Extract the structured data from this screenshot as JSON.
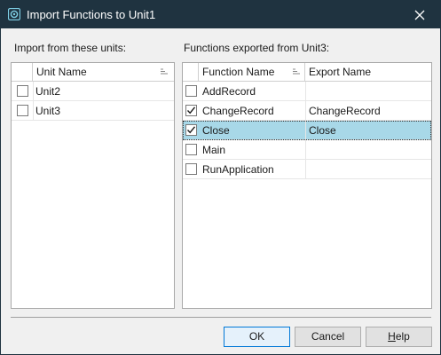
{
  "window": {
    "title": "Import Functions to Unit1",
    "colors": {
      "titlebar": "#1f3340",
      "selection": "#a8d8e8"
    },
    "icons": {
      "app": "app-icon",
      "close": "close-icon"
    }
  },
  "left_panel": {
    "label": "Import from these units:",
    "column_header": "Unit Name",
    "rows": [
      {
        "label": "Unit2",
        "checked": false
      },
      {
        "label": "Unit3",
        "checked": false
      }
    ]
  },
  "right_panel": {
    "label": "Functions exported from Unit3:",
    "columns": [
      "Function Name",
      "Export Name"
    ],
    "rows": [
      {
        "function": "AddRecord",
        "export": "",
        "checked": false
      },
      {
        "function": "ChangeRecord",
        "export": "ChangeRecord",
        "checked": true
      },
      {
        "function": "Close",
        "export": "Close",
        "checked": true,
        "selected": true
      },
      {
        "function": "Main",
        "export": "",
        "checked": false
      },
      {
        "function": "RunApplication",
        "export": "",
        "checked": false
      }
    ]
  },
  "buttons": {
    "ok": "OK",
    "cancel": "Cancel",
    "help_prefix": "",
    "help_mnemonic": "H",
    "help_rest": "elp"
  }
}
